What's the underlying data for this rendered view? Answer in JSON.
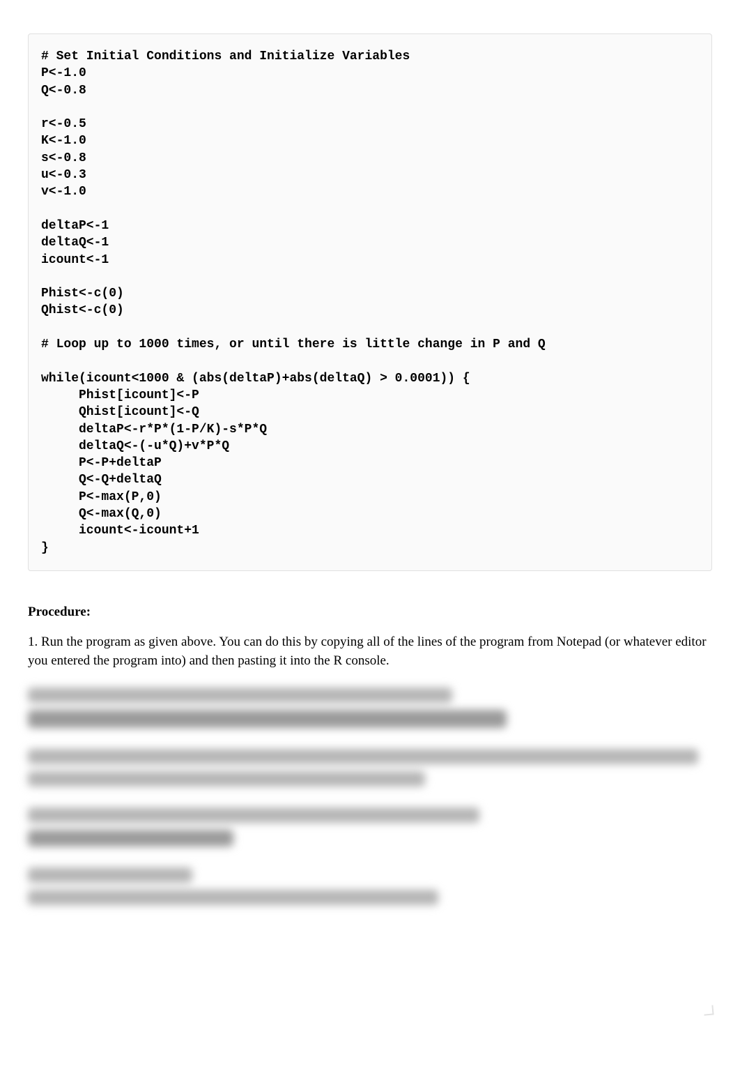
{
  "code": {
    "lines": [
      "# Set Initial Conditions and Initialize Variables",
      "P<-1.0",
      "Q<-0.8",
      "",
      "r<-0.5",
      "K<-1.0",
      "s<-0.8",
      "u<-0.3",
      "v<-1.0",
      "",
      "deltaP<-1",
      "deltaQ<-1",
      "icount<-1",
      "",
      "Phist<-c(0)",
      "Qhist<-c(0)",
      "",
      "# Loop up to 1000 times, or until there is little change in P and Q",
      "",
      "while(icount<1000 & (abs(deltaP)+abs(deltaQ) > 0.0001)) {",
      "     Phist[icount]<-P",
      "     Qhist[icount]<-Q",
      "     deltaP<-r*P*(1-P/K)-s*P*Q",
      "     deltaQ<-(-u*Q)+v*P*Q",
      "     P<-P+deltaP",
      "     Q<-Q+deltaQ",
      "     P<-max(P,0)",
      "     Q<-max(Q,0)",
      "     icount<-icount+1",
      "}"
    ]
  },
  "procedure": {
    "heading": "Procedure:",
    "step1": "1. Run the program as given above.  You can do this by copying all of the lines of the program from Notepad (or whatever editor you entered the program into) and then pasting it into the R console."
  }
}
